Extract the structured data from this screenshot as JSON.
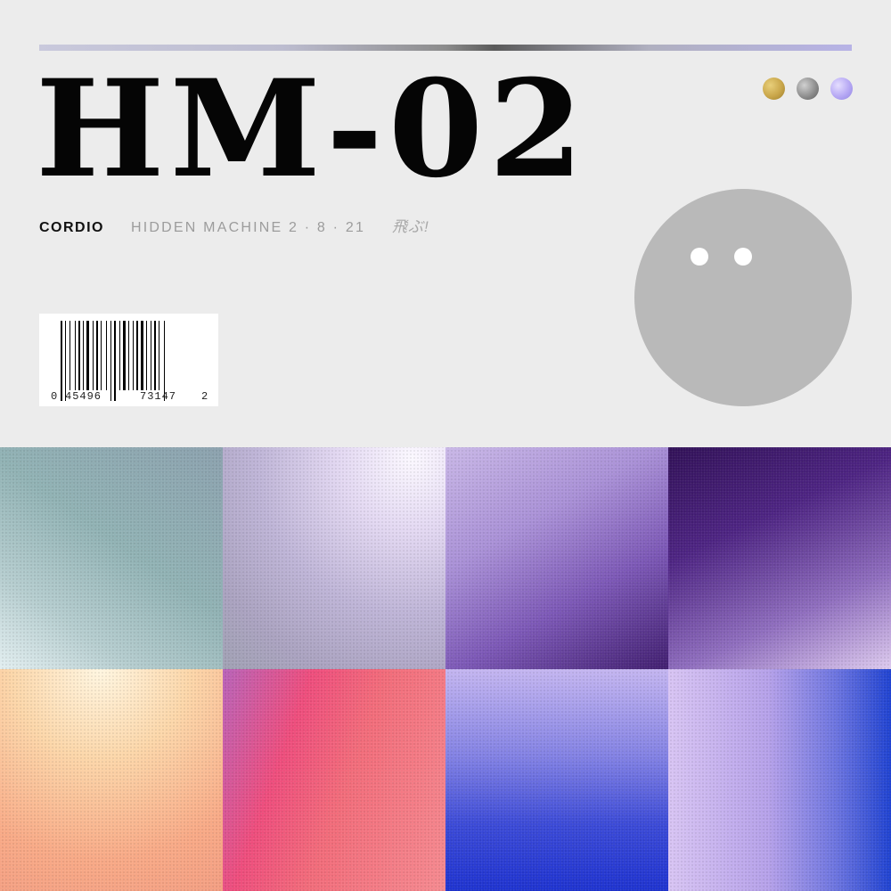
{
  "cover": {
    "title": "HM-02",
    "artist": "CORDIO",
    "subtitle": "HIDDEN MACHINE 2 · 8 · 21",
    "japanese": "飛ぶ!"
  },
  "swatches": [
    {
      "name": "gold",
      "color": "#c9a64a"
    },
    {
      "name": "silver",
      "color": "#8f8f8f"
    },
    {
      "name": "lavender",
      "color": "#b6a8f4"
    }
  ],
  "barcode": {
    "lead_digit": "0",
    "left_group": "45496",
    "right_group": "73147",
    "trailing_digit": "2"
  },
  "face": {
    "color": "#b9b9b9",
    "eye_color": "#ffffff"
  },
  "tiles": [
    {
      "name": "teal-grain"
    },
    {
      "name": "silver-lilac-grain"
    },
    {
      "name": "violet-grain"
    },
    {
      "name": "deep-purple-grain"
    },
    {
      "name": "peach-grain"
    },
    {
      "name": "coral-magenta-grain"
    },
    {
      "name": "cobalt-grain"
    },
    {
      "name": "lilac-blue-grain"
    }
  ]
}
